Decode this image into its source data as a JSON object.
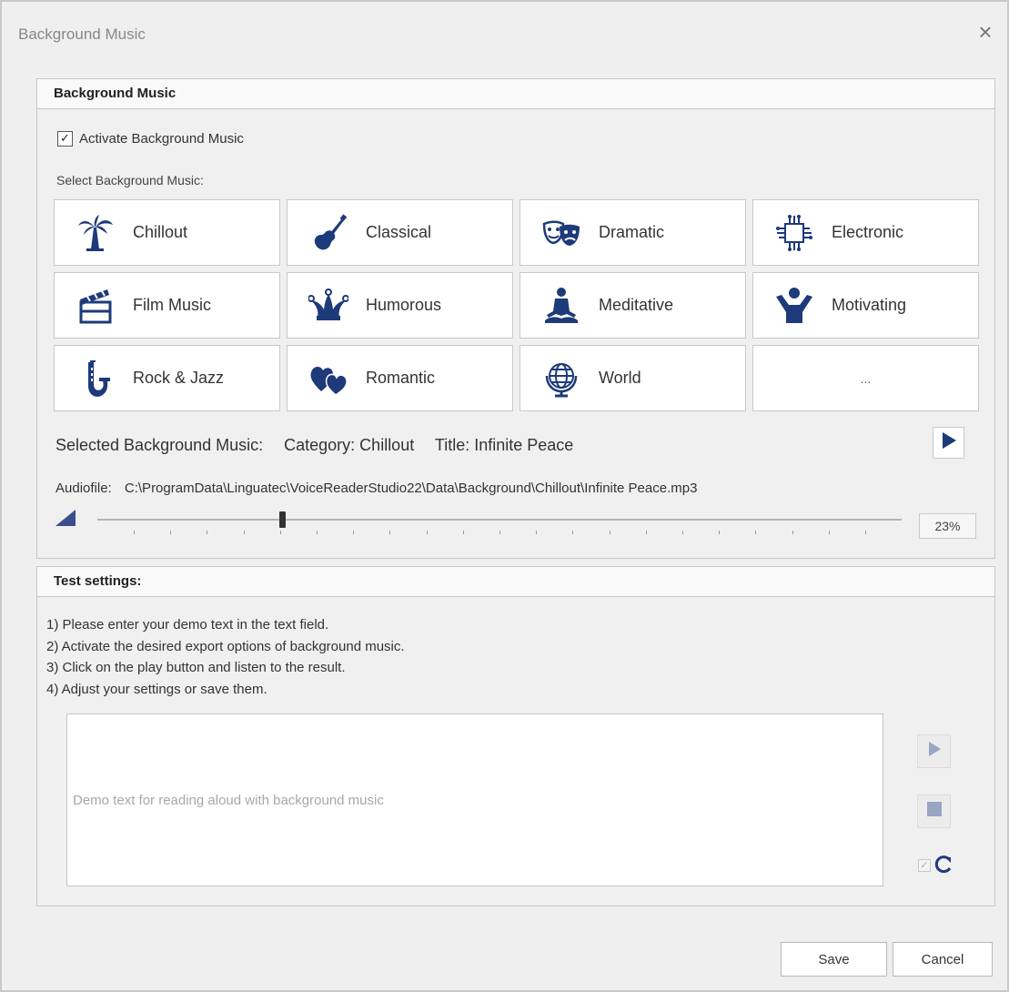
{
  "window": {
    "title": "Background Music",
    "close_icon": "close-icon"
  },
  "colors": {
    "accent": "#1d3a7a",
    "disabled": "#9aa5c3"
  },
  "music_group": {
    "header": "Background Music",
    "activate": {
      "label": "Activate Background Music",
      "checked": true
    },
    "select_label": "Select Background Music:",
    "tiles": [
      {
        "label": "Chillout",
        "icon": "palm-tree-icon"
      },
      {
        "label": "Classical",
        "icon": "violin-icon"
      },
      {
        "label": "Dramatic",
        "icon": "theater-masks-icon"
      },
      {
        "label": "Electronic",
        "icon": "circuit-chip-icon"
      },
      {
        "label": "Film Music",
        "icon": "clapperboard-icon"
      },
      {
        "label": "Humorous",
        "icon": "jester-hat-icon"
      },
      {
        "label": "Meditative",
        "icon": "meditation-icon"
      },
      {
        "label": "Motivating",
        "icon": "cheering-person-icon"
      },
      {
        "label": "Rock & Jazz",
        "icon": "saxophone-icon"
      },
      {
        "label": "Romantic",
        "icon": "hearts-icon"
      },
      {
        "label": "World",
        "icon": "globe-icon"
      },
      {
        "label": "...",
        "icon": ""
      }
    ],
    "selected_label": "Selected Background Music:",
    "category_text": "Category: Chillout",
    "title_text": "Title: Infinite Peace",
    "audiofile_label": "Audiofile:",
    "audiofile_path": "C:\\ProgramData\\Linguatec\\VoiceReaderStudio22\\Data\\Background\\Chillout\\Infinite Peace.mp3",
    "volume_percent": 23,
    "volume_text": "23%"
  },
  "test_group": {
    "header": "Test settings:",
    "steps": [
      "1) Please enter your demo text in the text field.",
      "2) Activate the desired export options of background music.",
      "3) Click on the play button and listen to the result.",
      "4) Adjust your settings or save them."
    ],
    "demo_placeholder": "Demo text for reading aloud with background music"
  },
  "buttons": {
    "save": "Save",
    "cancel": "Cancel"
  }
}
